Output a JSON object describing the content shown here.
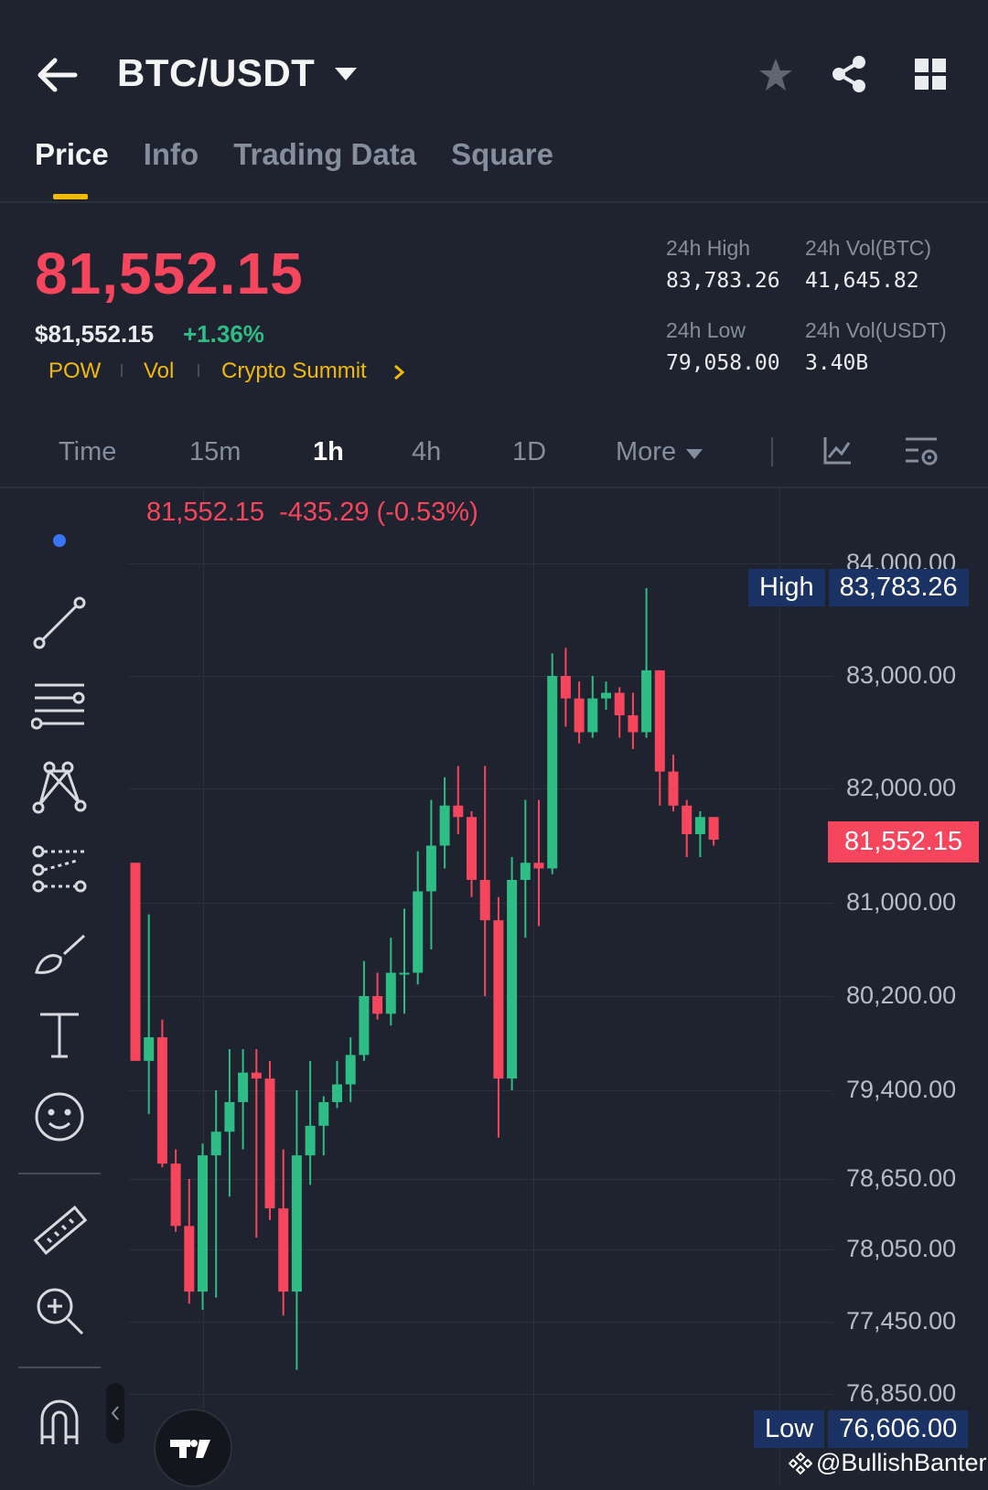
{
  "header": {
    "pair": "BTC/USDT"
  },
  "tabs": [
    {
      "label": "Price",
      "active": true
    },
    {
      "label": "Info"
    },
    {
      "label": "Trading Data"
    },
    {
      "label": "Square"
    }
  ],
  "ticker": {
    "last_price": "81,552.15",
    "usd_price": "$81,552.15",
    "change_pct": "+1.36%",
    "tags": [
      "POW",
      "Vol",
      "Crypto Summit"
    ],
    "high_label": "24h High",
    "high_value": "83,783.26",
    "low_label": "24h Low",
    "low_value": "79,058.00",
    "vol_btc_label": "24h Vol(BTC)",
    "vol_btc_value": "41,645.82",
    "vol_usdt_label": "24h Vol(USDT)",
    "vol_usdt_value": "3.40B"
  },
  "intervals": [
    "Time",
    "15m",
    "1h",
    "4h",
    "1D",
    "More"
  ],
  "active_interval": "1h",
  "chart_info": {
    "price": "81,552.15",
    "change": "-435.29 (-0.53%)"
  },
  "badges": {
    "high_label": "High",
    "high_value": "83,783.26",
    "current": "81,552.15",
    "low_label": "Low",
    "low_value": "76,606.00"
  },
  "watermark": "@BullishBanter",
  "colors": {
    "up": "#2ebd85",
    "down": "#f6465d",
    "accent": "#f0b90b",
    "bg": "#1f2330"
  },
  "chart_data": {
    "type": "candlestick",
    "interval": "1h",
    "y_tick_labels": [
      "84,000.00",
      "83,000.00",
      "82,000.00",
      "81,000.00",
      "80,200.00",
      "79,400.00",
      "78,650.00",
      "78,050.00",
      "77,450.00",
      "76,850.00"
    ],
    "y_ticks": [
      84000,
      83000,
      82000,
      81000,
      80200,
      79400,
      78650,
      78050,
      77450,
      76850
    ],
    "candles": [
      {
        "o": 81350,
        "h": 81350,
        "l": 79650,
        "c": 79650
      },
      {
        "o": 79650,
        "h": 80900,
        "l": 79200,
        "c": 79850
      },
      {
        "o": 79850,
        "h": 80000,
        "l": 78750,
        "c": 78780
      },
      {
        "o": 78780,
        "h": 78900,
        "l": 78200,
        "c": 78250
      },
      {
        "o": 78250,
        "h": 78650,
        "l": 77600,
        "c": 77700
      },
      {
        "o": 77700,
        "h": 78950,
        "l": 77550,
        "c": 78850
      },
      {
        "o": 78850,
        "h": 79400,
        "l": 77650,
        "c": 79050
      },
      {
        "o": 79050,
        "h": 79750,
        "l": 78500,
        "c": 79300
      },
      {
        "o": 79300,
        "h": 79750,
        "l": 78900,
        "c": 79550
      },
      {
        "o": 79550,
        "h": 79750,
        "l": 78150,
        "c": 79500
      },
      {
        "o": 79500,
        "h": 79650,
        "l": 78300,
        "c": 78400
      },
      {
        "o": 78400,
        "h": 78900,
        "l": 77500,
        "c": 77700
      },
      {
        "o": 77700,
        "h": 79400,
        "l": 77050,
        "c": 78850
      },
      {
        "o": 78850,
        "h": 79650,
        "l": 78600,
        "c": 79100
      },
      {
        "o": 79100,
        "h": 79350,
        "l": 78850,
        "c": 79300
      },
      {
        "o": 79300,
        "h": 79650,
        "l": 79250,
        "c": 79450
      },
      {
        "o": 79450,
        "h": 79850,
        "l": 79300,
        "c": 79700
      },
      {
        "o": 79700,
        "h": 80500,
        "l": 79650,
        "c": 80200
      },
      {
        "o": 80200,
        "h": 80400,
        "l": 80000,
        "c": 80050
      },
      {
        "o": 80050,
        "h": 80700,
        "l": 79950,
        "c": 80400
      },
      {
        "o": 80400,
        "h": 80950,
        "l": 80050,
        "c": 80400
      },
      {
        "o": 80400,
        "h": 81450,
        "l": 80300,
        "c": 81100
      },
      {
        "o": 81100,
        "h": 81900,
        "l": 80600,
        "c": 81500
      },
      {
        "o": 81500,
        "h": 82100,
        "l": 81300,
        "c": 81850
      },
      {
        "o": 81850,
        "h": 82200,
        "l": 81600,
        "c": 81750
      },
      {
        "o": 81750,
        "h": 81800,
        "l": 81050,
        "c": 81200
      },
      {
        "o": 81200,
        "h": 82200,
        "l": 80200,
        "c": 80850
      },
      {
        "o": 80850,
        "h": 81050,
        "l": 79000,
        "c": 79500
      },
      {
        "o": 79500,
        "h": 81400,
        "l": 79400,
        "c": 81200
      },
      {
        "o": 81200,
        "h": 81900,
        "l": 80700,
        "c": 81350
      },
      {
        "o": 81350,
        "h": 81900,
        "l": 80800,
        "c": 81300
      },
      {
        "o": 81300,
        "h": 83200,
        "l": 81250,
        "c": 83000
      },
      {
        "o": 83000,
        "h": 83250,
        "l": 82550,
        "c": 82800
      },
      {
        "o": 82800,
        "h": 82950,
        "l": 82400,
        "c": 82500
      },
      {
        "o": 82500,
        "h": 83000,
        "l": 82450,
        "c": 82800
      },
      {
        "o": 82800,
        "h": 82950,
        "l": 82700,
        "c": 82850
      },
      {
        "o": 82850,
        "h": 82900,
        "l": 82450,
        "c": 82650
      },
      {
        "o": 82650,
        "h": 82850,
        "l": 82350,
        "c": 82500
      },
      {
        "o": 82500,
        "h": 83780,
        "l": 82450,
        "c": 83050
      },
      {
        "o": 83050,
        "h": 83050,
        "l": 81850,
        "c": 82150
      },
      {
        "o": 82150,
        "h": 82300,
        "l": 81800,
        "c": 81850
      },
      {
        "o": 81850,
        "h": 81900,
        "l": 81400,
        "c": 81600
      },
      {
        "o": 81600,
        "h": 81800,
        "l": 81400,
        "c": 81750
      },
      {
        "o": 81750,
        "h": 81750,
        "l": 81500,
        "c": 81552
      }
    ]
  }
}
